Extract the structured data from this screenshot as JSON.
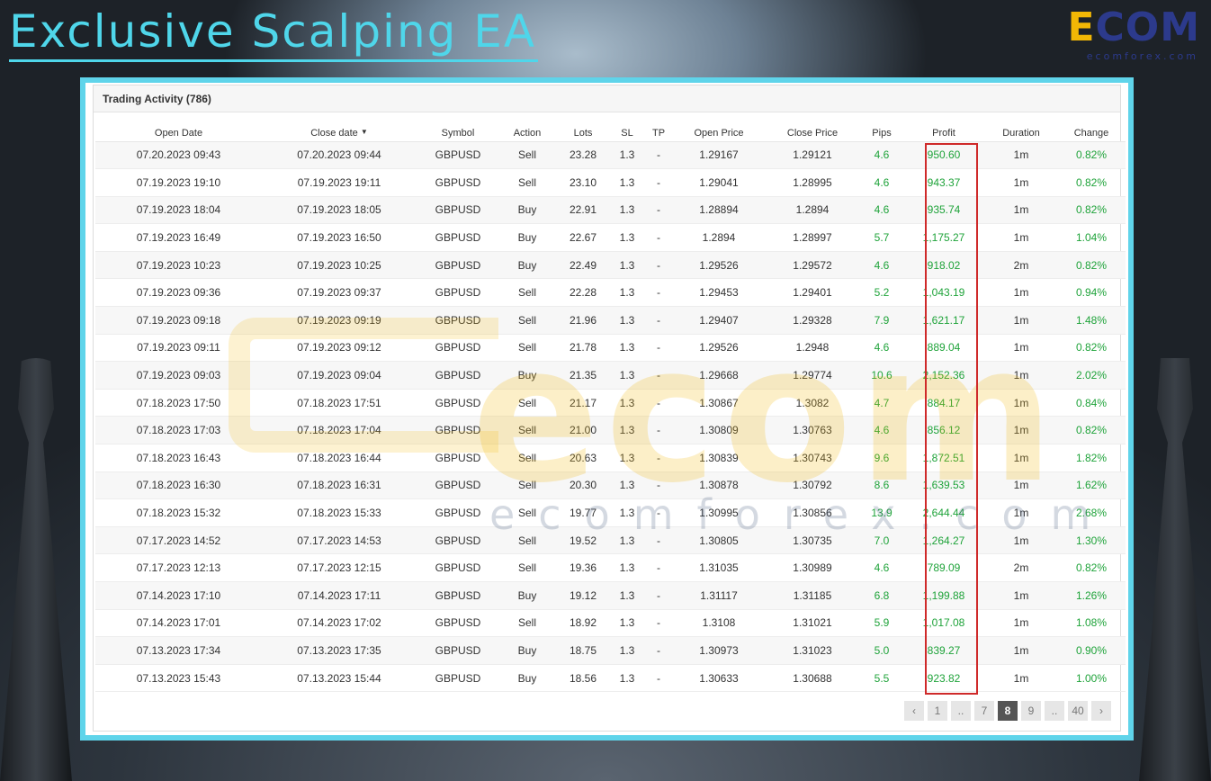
{
  "page_title": "Exclusive Scalping EA",
  "logo": {
    "word_e": "E",
    "word_rest": "COM",
    "sub": "ecomforex.com",
    "watermark_main": "ecom",
    "watermark_sub": "ecomforex.com"
  },
  "panel": {
    "title": "Trading Activity (786)",
    "columns": [
      "Open Date",
      "Close date",
      "Symbol",
      "Action",
      "Lots",
      "SL",
      "TP",
      "Open Price",
      "Close Price",
      "Pips",
      "Profit",
      "Duration",
      "Change"
    ],
    "sort_indicator": "▼",
    "rows": [
      [
        "07.20.2023 09:43",
        "07.20.2023 09:44",
        "GBPUSD",
        "Sell",
        "23.28",
        "1.3",
        "-",
        "1.29167",
        "1.29121",
        "4.6",
        "950.60",
        "1m",
        "0.82%"
      ],
      [
        "07.19.2023 19:10",
        "07.19.2023 19:11",
        "GBPUSD",
        "Sell",
        "23.10",
        "1.3",
        "-",
        "1.29041",
        "1.28995",
        "4.6",
        "943.37",
        "1m",
        "0.82%"
      ],
      [
        "07.19.2023 18:04",
        "07.19.2023 18:05",
        "GBPUSD",
        "Buy",
        "22.91",
        "1.3",
        "-",
        "1.28894",
        "1.2894",
        "4.6",
        "935.74",
        "1m",
        "0.82%"
      ],
      [
        "07.19.2023 16:49",
        "07.19.2023 16:50",
        "GBPUSD",
        "Buy",
        "22.67",
        "1.3",
        "-",
        "1.2894",
        "1.28997",
        "5.7",
        "1,175.27",
        "1m",
        "1.04%"
      ],
      [
        "07.19.2023 10:23",
        "07.19.2023 10:25",
        "GBPUSD",
        "Buy",
        "22.49",
        "1.3",
        "-",
        "1.29526",
        "1.29572",
        "4.6",
        "918.02",
        "2m",
        "0.82%"
      ],
      [
        "07.19.2023 09:36",
        "07.19.2023 09:37",
        "GBPUSD",
        "Sell",
        "22.28",
        "1.3",
        "-",
        "1.29453",
        "1.29401",
        "5.2",
        "1,043.19",
        "1m",
        "0.94%"
      ],
      [
        "07.19.2023 09:18",
        "07.19.2023 09:19",
        "GBPUSD",
        "Sell",
        "21.96",
        "1.3",
        "-",
        "1.29407",
        "1.29328",
        "7.9",
        "1,621.17",
        "1m",
        "1.48%"
      ],
      [
        "07.19.2023 09:11",
        "07.19.2023 09:12",
        "GBPUSD",
        "Sell",
        "21.78",
        "1.3",
        "-",
        "1.29526",
        "1.2948",
        "4.6",
        "889.04",
        "1m",
        "0.82%"
      ],
      [
        "07.19.2023 09:03",
        "07.19.2023 09:04",
        "GBPUSD",
        "Buy",
        "21.35",
        "1.3",
        "-",
        "1.29668",
        "1.29774",
        "10.6",
        "2,152.36",
        "1m",
        "2.02%"
      ],
      [
        "07.18.2023 17:50",
        "07.18.2023 17:51",
        "GBPUSD",
        "Sell",
        "21.17",
        "1.3",
        "-",
        "1.30867",
        "1.3082",
        "4.7",
        "884.17",
        "1m",
        "0.84%"
      ],
      [
        "07.18.2023 17:03",
        "07.18.2023 17:04",
        "GBPUSD",
        "Sell",
        "21.00",
        "1.3",
        "-",
        "1.30809",
        "1.30763",
        "4.6",
        "856.12",
        "1m",
        "0.82%"
      ],
      [
        "07.18.2023 16:43",
        "07.18.2023 16:44",
        "GBPUSD",
        "Sell",
        "20.63",
        "1.3",
        "-",
        "1.30839",
        "1.30743",
        "9.6",
        "1,872.51",
        "1m",
        "1.82%"
      ],
      [
        "07.18.2023 16:30",
        "07.18.2023 16:31",
        "GBPUSD",
        "Sell",
        "20.30",
        "1.3",
        "-",
        "1.30878",
        "1.30792",
        "8.6",
        "1,639.53",
        "1m",
        "1.62%"
      ],
      [
        "07.18.2023 15:32",
        "07.18.2023 15:33",
        "GBPUSD",
        "Sell",
        "19.77",
        "1.3",
        "-",
        "1.30995",
        "1.30856",
        "13.9",
        "2,644.44",
        "1m",
        "2.68%"
      ],
      [
        "07.17.2023 14:52",
        "07.17.2023 14:53",
        "GBPUSD",
        "Sell",
        "19.52",
        "1.3",
        "-",
        "1.30805",
        "1.30735",
        "7.0",
        "1,264.27",
        "1m",
        "1.30%"
      ],
      [
        "07.17.2023 12:13",
        "07.17.2023 12:15",
        "GBPUSD",
        "Sell",
        "19.36",
        "1.3",
        "-",
        "1.31035",
        "1.30989",
        "4.6",
        "789.09",
        "2m",
        "0.82%"
      ],
      [
        "07.14.2023 17:10",
        "07.14.2023 17:11",
        "GBPUSD",
        "Buy",
        "19.12",
        "1.3",
        "-",
        "1.31117",
        "1.31185",
        "6.8",
        "1,199.88",
        "1m",
        "1.26%"
      ],
      [
        "07.14.2023 17:01",
        "07.14.2023 17:02",
        "GBPUSD",
        "Sell",
        "18.92",
        "1.3",
        "-",
        "1.3108",
        "1.31021",
        "5.9",
        "1,017.08",
        "1m",
        "1.08%"
      ],
      [
        "07.13.2023 17:34",
        "07.13.2023 17:35",
        "GBPUSD",
        "Buy",
        "18.75",
        "1.3",
        "-",
        "1.30973",
        "1.31023",
        "5.0",
        "839.27",
        "1m",
        "0.90%"
      ],
      [
        "07.13.2023 15:43",
        "07.13.2023 15:44",
        "GBPUSD",
        "Buy",
        "18.56",
        "1.3",
        "-",
        "1.30633",
        "1.30688",
        "5.5",
        "923.82",
        "1m",
        "1.00%"
      ]
    ]
  },
  "pagination": {
    "prev": "‹",
    "items": [
      "1",
      "..",
      "7",
      "8",
      "9",
      "..",
      "40"
    ],
    "active": "8",
    "next": "›"
  },
  "colors": {
    "accent": "#5fd4ea",
    "positive": "#1fa33a",
    "highlight_border": "#cf2a2a",
    "logo_blue": "#2c3a8c",
    "logo_yellow": "#f2b705"
  }
}
